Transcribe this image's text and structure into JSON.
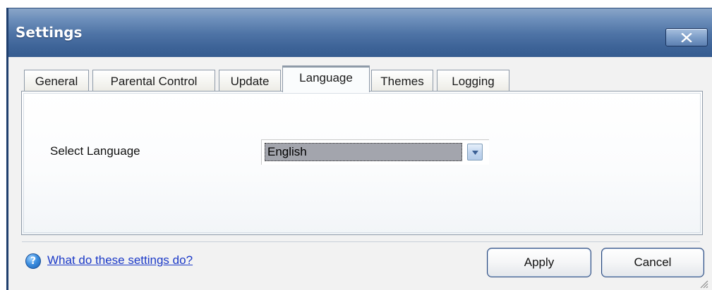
{
  "window": {
    "title": "Settings"
  },
  "tabs": [
    {
      "label": "General",
      "active": false
    },
    {
      "label": "Parental Control",
      "active": false
    },
    {
      "label": "Update",
      "active": false
    },
    {
      "label": "Language",
      "active": true
    },
    {
      "label": "Themes",
      "active": false
    },
    {
      "label": "Logging",
      "active": false
    }
  ],
  "language_panel": {
    "label": "Select Language",
    "selected": "English"
  },
  "footer": {
    "help_link": "What do these settings do?",
    "apply_label": "Apply",
    "cancel_label": "Cancel"
  },
  "icons": {
    "close": "close-icon",
    "help": "help-icon",
    "dropdown": "chevron-down-icon",
    "resize": "resize-grip-icon"
  },
  "colors": {
    "titlebar": "#4f74a6",
    "active_tab_accent": "#f2b13b",
    "link": "#1b39c7",
    "selection": "#a3a5ad"
  }
}
